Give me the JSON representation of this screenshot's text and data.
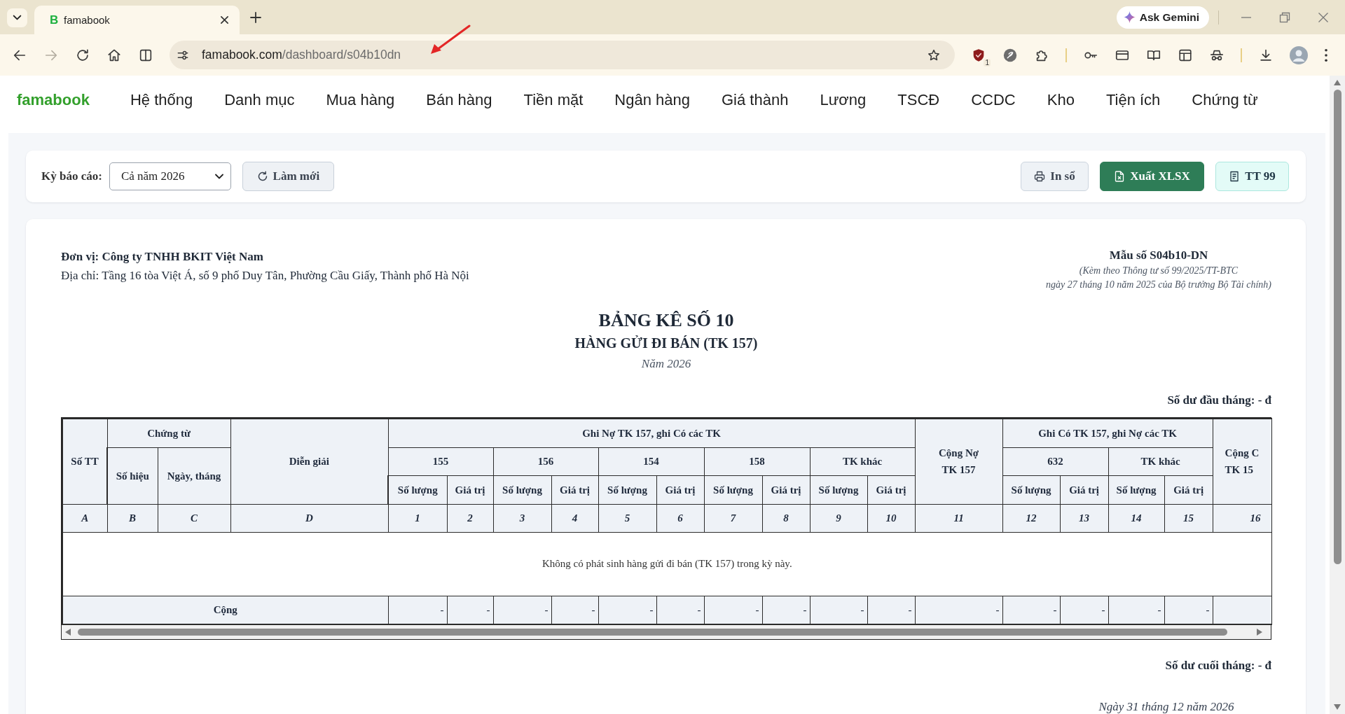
{
  "browser": {
    "tab": {
      "favicon": "B",
      "title": "famabook",
      "selected": true
    },
    "ask_gemini": "Ask Gemini",
    "history_buttons": [
      {
        "kind": "back",
        "disabled": false
      },
      {
        "kind": "forward",
        "disabled": true
      }
    ],
    "address_bar": {
      "host": "famabook.com",
      "path": "/dashboard/s04b10dn",
      "bookmarked": false
    },
    "extension_badge": "1"
  },
  "nav": {
    "brand": "famabook",
    "items": [
      "Hệ thống",
      "Danh mục",
      "Mua hàng",
      "Bán hàng",
      "Tiền mặt",
      "Ngân hàng",
      "Giá thành",
      "Lương",
      "TSCĐ",
      "CCDC",
      "Kho",
      "Tiện ích",
      "Chứng từ"
    ]
  },
  "toolbar": {
    "period_label": "Kỳ báo cáo:",
    "period_select": "Cả năm 2026",
    "refresh": "Làm mới",
    "actions": [
      {
        "kind": "print",
        "label": "In sổ"
      },
      {
        "kind": "export",
        "label": "Xuất XLSX"
      },
      {
        "kind": "circular",
        "label": "TT 99"
      }
    ]
  },
  "report": {
    "unit": "Đơn vị: Công ty TNHH BKIT Việt Nam",
    "address": "Địa chỉ: Tầng 16 tòa Việt Á, số 9 phố Duy Tân, Phường Cầu Giấy, Thành phố Hà Nội",
    "form_no": "Mẫu số S04b10-DN",
    "form_note": [
      "(Kèm theo Thông tư số 99/2025/TT-BTC",
      "ngày 27 tháng 10 năm 2025 của Bộ trưởng Bộ Tài chính)"
    ],
    "title": "BẢNG KÊ SỐ 10",
    "subtitle": "HÀNG GỬI ĐI BÁN (TK 157)",
    "period": "Năm 2026",
    "opening_balance": "Số dư đầu tháng: - đ",
    "table": {
      "header": [
        {
          "label": "Số TT"
        },
        {
          "label": "Chứng từ",
          "children": [
            {
              "label": "Số hiệu"
            },
            {
              "label": "Ngày, tháng"
            }
          ]
        },
        {
          "label": "Diễn giải"
        },
        {
          "label": "Ghi Nợ TK 157, ghi Có các TK",
          "children": [
            {
              "label": "155",
              "children": [
                {
                  "label": "Số lượng"
                },
                {
                  "label": "Giá trị"
                }
              ]
            },
            {
              "label": "156",
              "children": [
                {
                  "label": "Số lượng"
                },
                {
                  "label": "Giá trị"
                }
              ]
            },
            {
              "label": "154",
              "children": [
                {
                  "label": "Số lượng"
                },
                {
                  "label": "Giá trị"
                }
              ]
            },
            {
              "label": "158",
              "children": [
                {
                  "label": "Số lượng"
                },
                {
                  "label": "Giá trị"
                }
              ]
            },
            {
              "label": "TK khác",
              "children": [
                {
                  "label": "Số lượng"
                },
                {
                  "label": "Giá trị"
                }
              ]
            }
          ]
        },
        {
          "label": "Cộng Nợ TK 157"
        },
        {
          "label": "Ghi Có TK 157, ghi Nợ các TK",
          "children": [
            {
              "label": "632",
              "children": [
                {
                  "label": "Số lượng"
                },
                {
                  "label": "Giá trị"
                }
              ]
            },
            {
              "label": "TK khác",
              "children": [
                {
                  "label": "Số lượng"
                },
                {
                  "label": "Giá trị"
                }
              ]
            }
          ]
        },
        {
          "label": "Cộng C TK 15"
        }
      ],
      "index_row": [
        "A",
        "B",
        "C",
        "D",
        "1",
        "2",
        "3",
        "4",
        "5",
        "6",
        "7",
        "8",
        "9",
        "10",
        "11",
        "12",
        "13",
        "14",
        "15",
        "16"
      ],
      "empty_message": "Không có phát sinh hàng gửi đi bán (TK 157) trong kỳ này.",
      "total_row": {
        "label": "Cộng",
        "values": [
          "-",
          "-",
          "-",
          "-",
          "-",
          "-",
          "-",
          "-",
          "-",
          "-",
          "-",
          "-",
          "-",
          "-",
          "-"
        ]
      }
    },
    "closing_balance": "Số dư cuối tháng: - đ",
    "sign_date": "Ngày 31 tháng 12 năm 2026"
  }
}
